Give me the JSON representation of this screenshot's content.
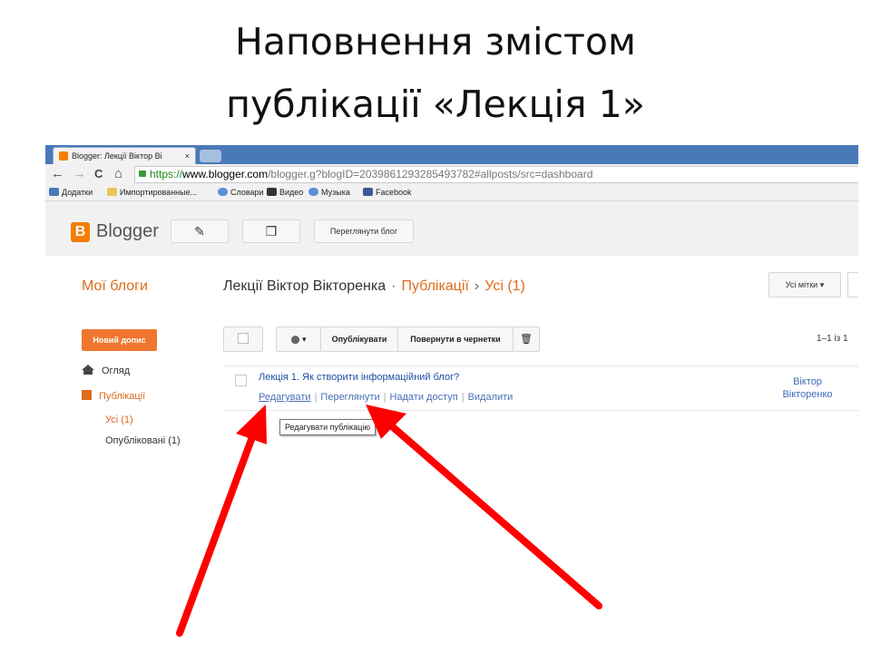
{
  "slide": {
    "title_line1": "Наповнення змістом",
    "title_line2": "публікації «Лекція 1»"
  },
  "browser": {
    "tab_title": "Blogger: Лекції Віктор Ві",
    "tab_close": "×",
    "nav": {
      "back": "←",
      "forward": "→",
      "reload": "C",
      "home": "⌂"
    },
    "url_scheme": "https://",
    "url_host": "www.blogger.com",
    "url_rest": "/blogger.g?blogID=2039861293285493782#allposts/src=dashboard",
    "bookmarks": [
      "Додатки",
      "Импортированные...",
      "Словари",
      "Видео",
      "Музыка",
      "Facebook"
    ]
  },
  "blogger": {
    "logo_letter": "B",
    "logo_text": "Blogger",
    "header_buttons": {
      "edit_icon": "✎",
      "copy_icon": "❐",
      "view_blog": "Переглянути блог"
    },
    "sidebar": {
      "title": "Мої блоги",
      "new_post": "Новий допис",
      "overview": "Огляд",
      "posts": "Публікації",
      "all": "Усі (1)",
      "published": "Опубліковані (1)"
    },
    "breadcrumb": {
      "blog_name": "Лекції Віктор Вікторенка",
      "dot": "·",
      "section": "Публікації",
      "arrow": "›",
      "filter": "Усі (1)"
    },
    "labels_button": "Усі мітки",
    "dropdown_arrow": "▾",
    "toolbar": {
      "label_icon": "⬤",
      "publish": "Опублікувати",
      "revert": "Повернути в чернетки",
      "delete_icon": "🗑"
    },
    "pager": "1–1 із 1",
    "post": {
      "title": "Лекція 1. Як створити інформаційний блог?",
      "actions": [
        "Редагувати",
        "Переглянути",
        "Надати доступ",
        "Видалити"
      ],
      "author_line1": "Віктор",
      "author_line2": "Вікторенко"
    },
    "tooltip": "Редагувати публікацію"
  },
  "colors": {
    "blogger_orange": "#f57d00",
    "link_blue": "#1e4fa3",
    "annotation_red": "#ff0000",
    "tab_strip": "#4a79b8"
  }
}
